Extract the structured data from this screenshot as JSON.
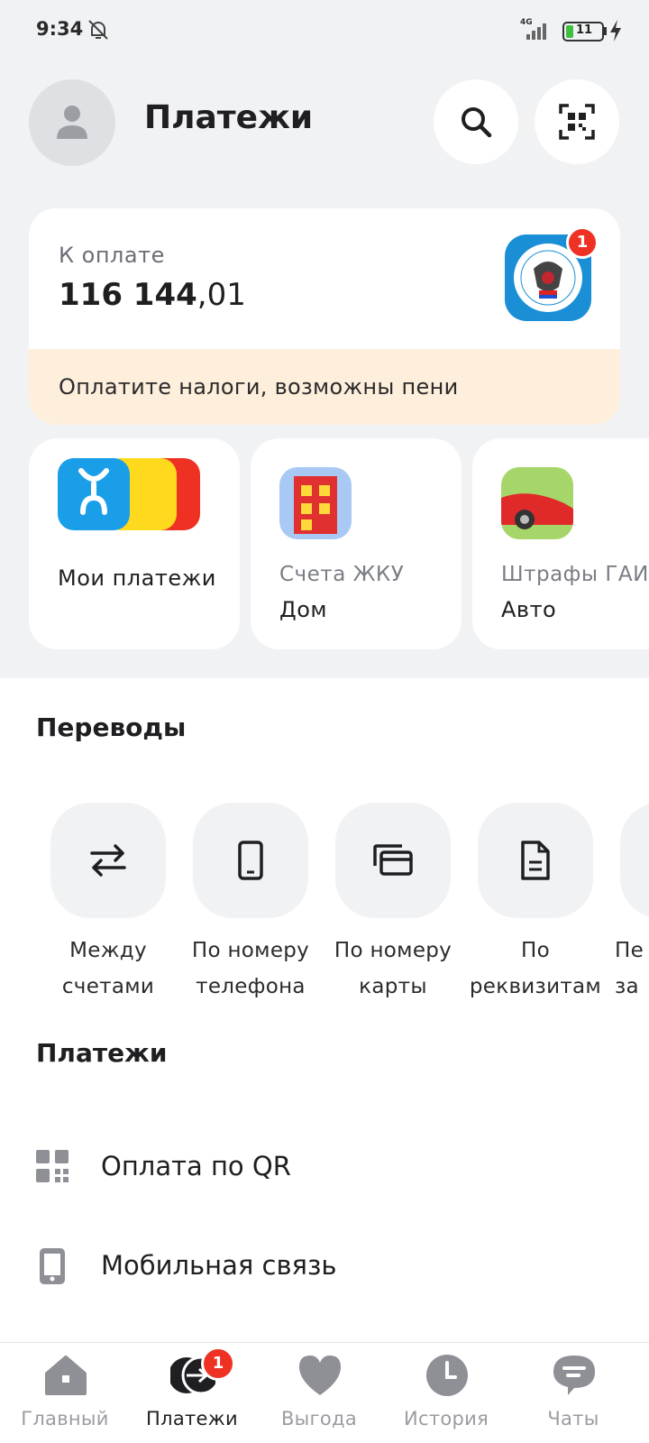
{
  "status_bar": {
    "time": "9:34",
    "network": "4G",
    "battery": "11"
  },
  "header": {
    "title": "Платежи"
  },
  "due": {
    "label": "К оплате",
    "amount_int": "116 144",
    "amount_dec": ",01",
    "badge": "1",
    "warning": "Оплатите налоги, возможны пени"
  },
  "shortcuts": [
    {
      "sub": "",
      "main": "Мои платежи"
    },
    {
      "sub": "Счета ЖКУ",
      "main": "Дом"
    },
    {
      "sub": "Штрафы ГАИ",
      "main": "Авто"
    }
  ],
  "transfers": {
    "title": "Переводы",
    "items": [
      {
        "label": "Между счетами",
        "icon": "arrows-exchange-icon"
      },
      {
        "label": "По номеру телефона",
        "icon": "phone-icon"
      },
      {
        "label": "По номеру карты",
        "icon": "card-icon"
      },
      {
        "label": "По реквизитам",
        "icon": "document-icon"
      },
      {
        "label": "Пе за",
        "icon": "partial-icon"
      }
    ]
  },
  "payments": {
    "title": "Платежи",
    "items": [
      {
        "label": "Оплата по QR",
        "icon": "qr-icon"
      },
      {
        "label": "Мобильная связь",
        "icon": "mobile-icon"
      }
    ]
  },
  "nav": {
    "items": [
      {
        "label": "Главный",
        "icon": "home-icon"
      },
      {
        "label": "Платежи",
        "icon": "payments-icon"
      },
      {
        "label": "Выгода",
        "icon": "heart-icon"
      },
      {
        "label": "История",
        "icon": "clock-icon"
      },
      {
        "label": "Чаты",
        "icon": "chat-icon"
      }
    ],
    "payments_badge": "1",
    "active": "Платежи"
  },
  "colors": {
    "accent_red": "#ef3124",
    "background_gray": "#f1f2f4",
    "warning_bg": "#fdefdc"
  }
}
